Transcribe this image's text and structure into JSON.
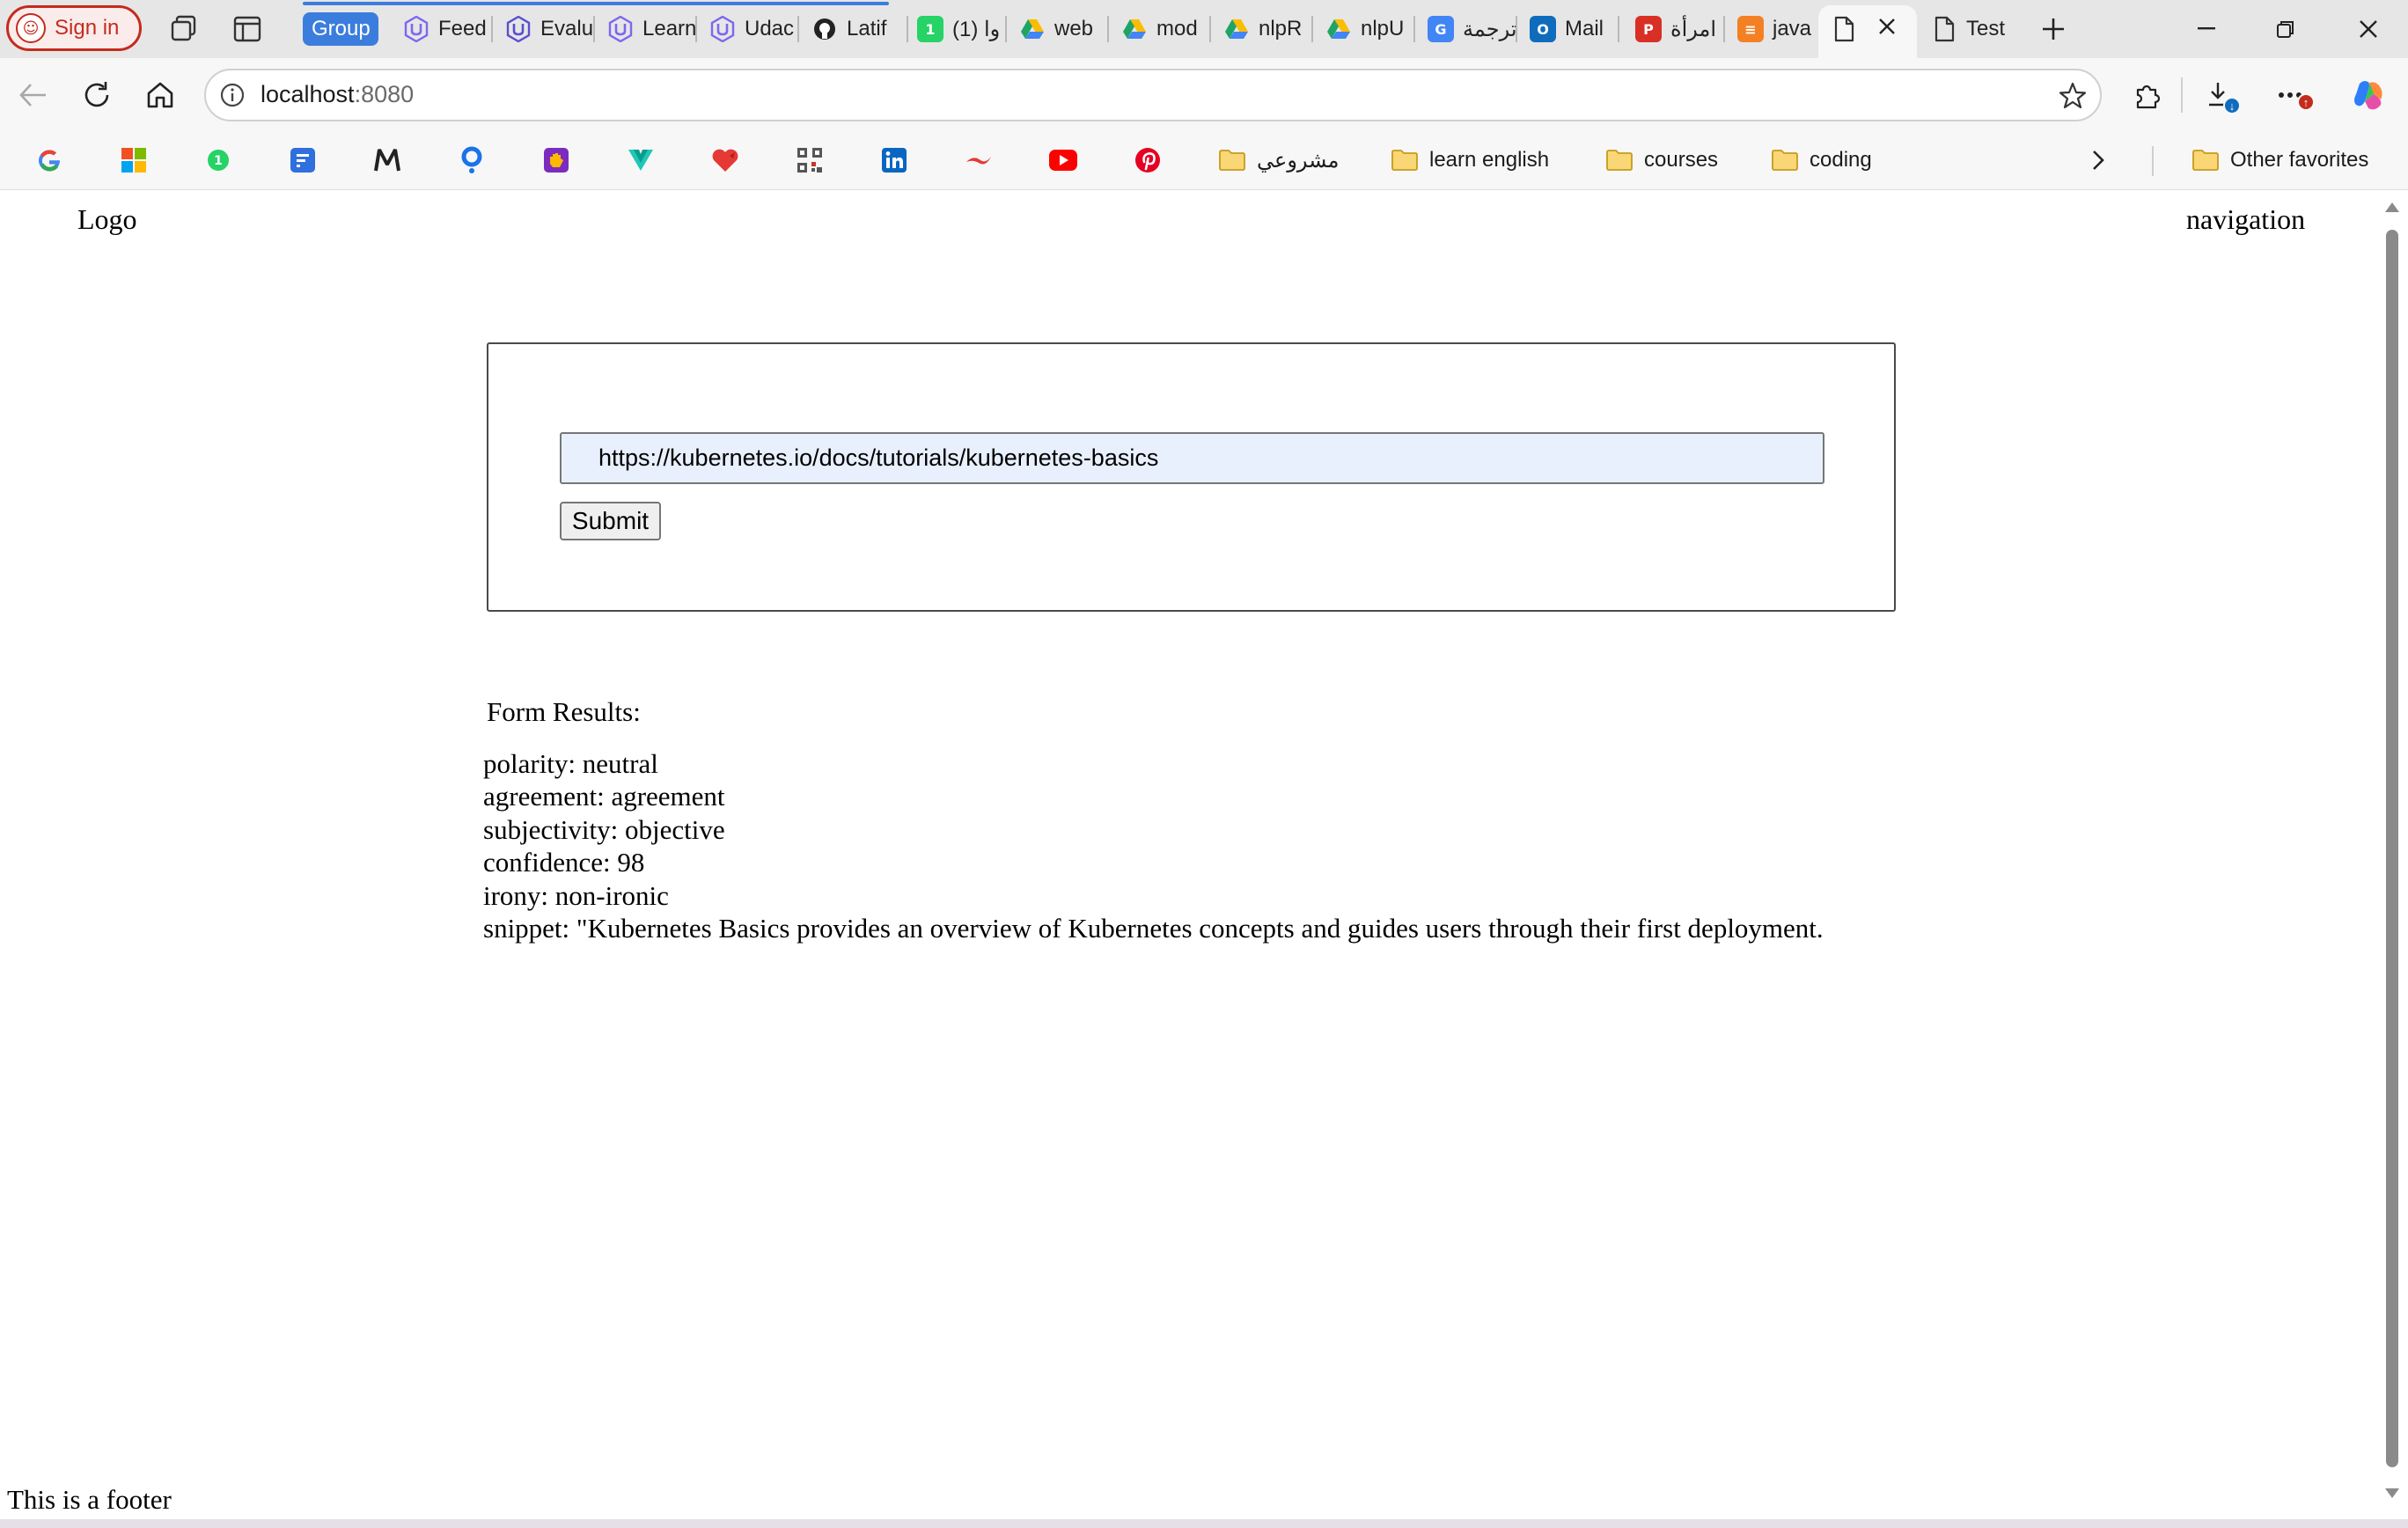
{
  "browser": {
    "signin_label": "Sign in",
    "group_label": "Group",
    "tabs": [
      {
        "label": "Feed",
        "icon": "udacity-icon",
        "color": "#7b68ee"
      },
      {
        "label": "Evalu",
        "icon": "udacity-icon",
        "color": "#5a4fcf"
      },
      {
        "label": "Learn",
        "icon": "udacity-icon",
        "color": "#7b68ee"
      },
      {
        "label": "Udac",
        "icon": "udacity-icon",
        "color": "#7b68ee"
      },
      {
        "label": "Latif",
        "icon": "github-icon",
        "color": "#222222"
      },
      {
        "label": "(1) وا",
        "icon": "whatsapp-icon",
        "color": "#25d366"
      },
      {
        "label": "web",
        "icon": "drive-icon",
        "color": "#1fa463"
      },
      {
        "label": "mod",
        "icon": "drive-icon",
        "color": "#1fa463"
      },
      {
        "label": "nlpR",
        "icon": "drive-icon",
        "color": "#1fa463"
      },
      {
        "label": "nlpU",
        "icon": "drive-icon",
        "color": "#1fa463"
      },
      {
        "label": "ترجمة",
        "icon": "translate-icon",
        "color": "#4285f4"
      },
      {
        "label": "Mail",
        "icon": "outlook-icon",
        "color": "#0f6cbd"
      },
      {
        "label": "امرأة",
        "icon": "pdf-icon",
        "color": "#d93025"
      },
      {
        "label": "java",
        "icon": "stackoverflow-icon",
        "color": "#f48024"
      },
      {
        "label": "",
        "icon": "page-icon",
        "color": "#444444"
      },
      {
        "label": "Test",
        "icon": "page-icon",
        "color": "#444444"
      }
    ],
    "url_host": "localhost",
    "url_port": ":8080",
    "download_badge": "↓",
    "more_badge": "↑"
  },
  "favorites": {
    "folders": [
      {
        "label": "مشروعي"
      },
      {
        "label": "learn english"
      },
      {
        "label": "courses"
      },
      {
        "label": "coding"
      }
    ],
    "other_label": "Other favorites"
  },
  "page": {
    "logo": "Logo",
    "navigation": "navigation",
    "form": {
      "url_value": "https://kubernetes.io/docs/tutorials/kubernetes-basics",
      "submit_label": "Submit"
    },
    "results_heading": "Form Results:",
    "results": {
      "polarity": "polarity: neutral",
      "agreement": "agreement: agreement",
      "subjectivity": "subjectivity: objective",
      "confidence": "confidence: 98",
      "irony": "irony: non-ironic",
      "snippet": "snippet: \"Kubernetes Basics provides an overview of Kubernetes concepts and guides users through their first deployment."
    },
    "footer": "This is a footer"
  },
  "colors": {
    "accent": "#3b7ddd",
    "signin": "#c42b1c",
    "autofill": "#e8f0fe"
  }
}
